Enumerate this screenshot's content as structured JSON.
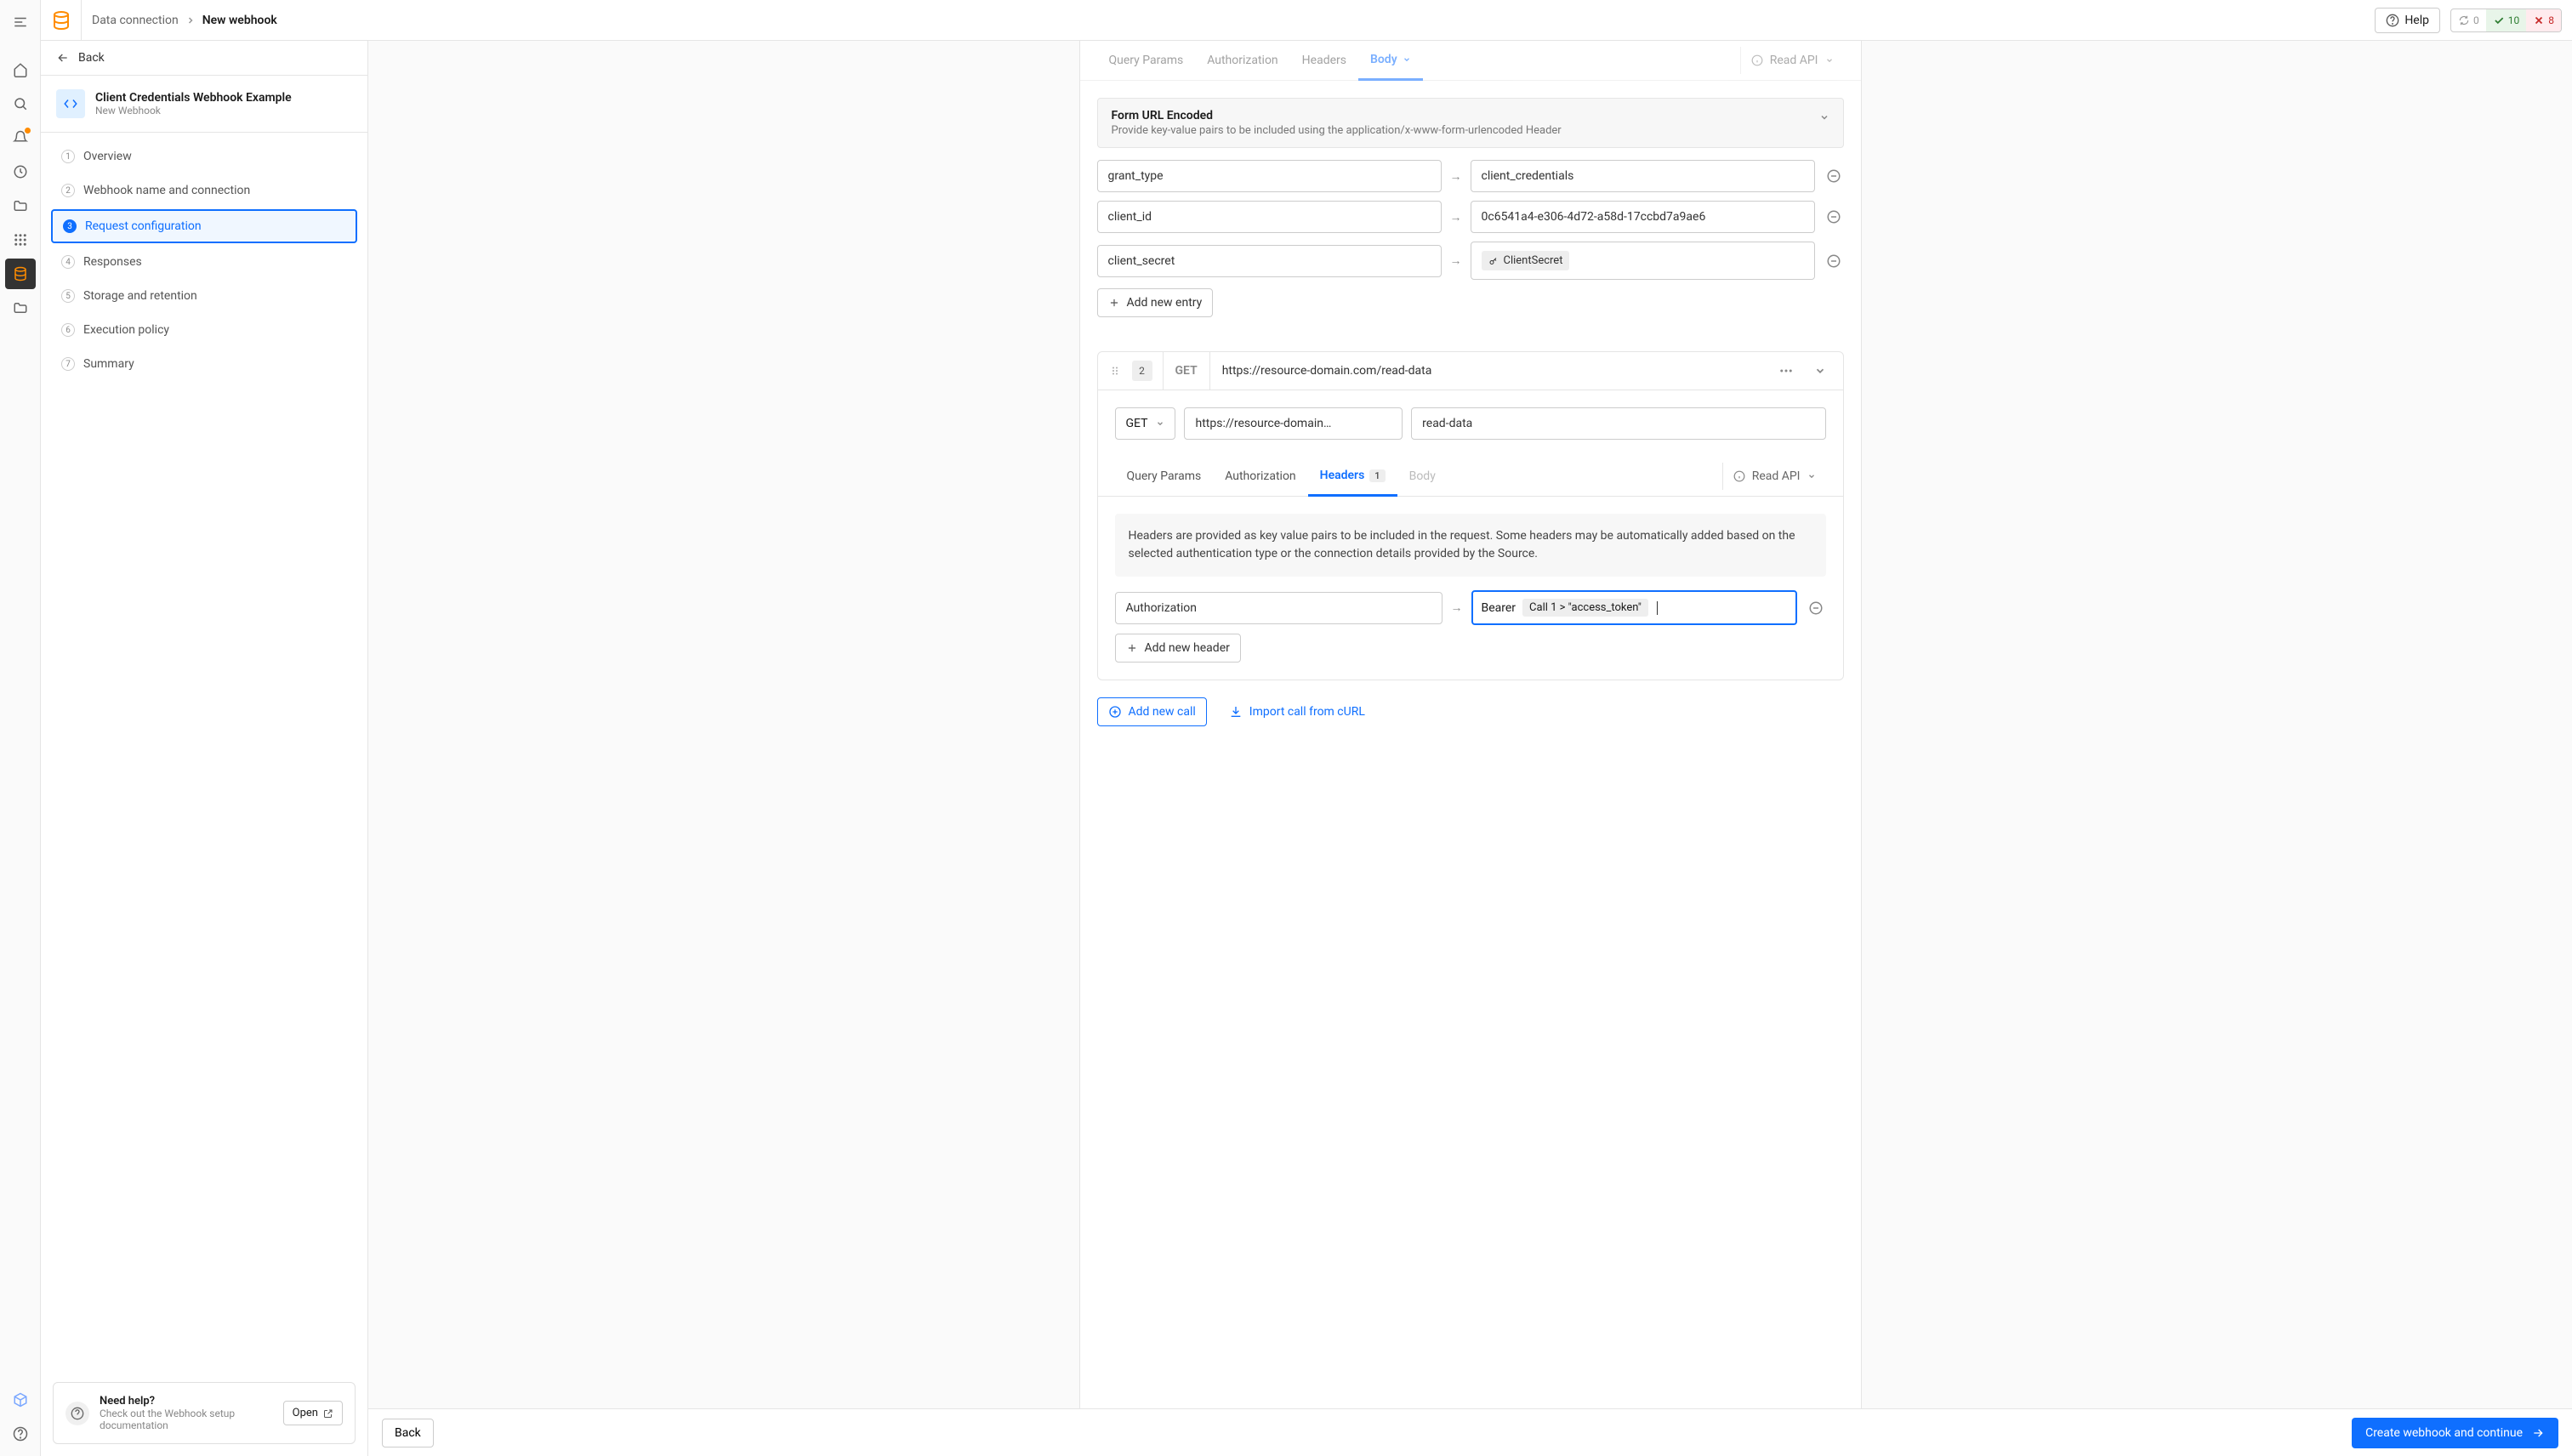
{
  "topbar": {
    "breadcrumb_root": "Data connection",
    "breadcrumb_current": "New webhook",
    "help_label": "Help",
    "status_sync": "0",
    "status_ok": "10",
    "status_err": "8"
  },
  "sidebar": {
    "back_label": "Back",
    "title": "Client Credentials Webhook Example",
    "subtitle": "New Webhook",
    "steps": [
      {
        "n": "1",
        "label": "Overview"
      },
      {
        "n": "2",
        "label": "Webhook name and connection"
      },
      {
        "n": "3",
        "label": "Request configuration"
      },
      {
        "n": "4",
        "label": "Responses"
      },
      {
        "n": "5",
        "label": "Storage and retention"
      },
      {
        "n": "6",
        "label": "Execution policy"
      },
      {
        "n": "7",
        "label": "Summary"
      }
    ],
    "help_title": "Need help?",
    "help_sub": "Check out the Webhook setup documentation",
    "open_label": "Open"
  },
  "body_section": {
    "tabs": {
      "qp": "Query Params",
      "auth": "Authorization",
      "headers": "Headers",
      "body": "Body"
    },
    "read_api": "Read API",
    "form_note_title": "Form URL Encoded",
    "form_note_sub": "Provide key-value pairs to be included using the application/x-www-form-urlencoded Header",
    "rows": [
      {
        "k": "grant_type",
        "v": "client_credentials"
      },
      {
        "k": "client_id",
        "v": "0c6541a4-e306-4d72-a58d-17ccbd7a9ae6"
      },
      {
        "k": "client_secret",
        "v": "ClientSecret"
      }
    ],
    "add_entry": "Add new entry"
  },
  "call2": {
    "num": "2",
    "method": "GET",
    "url": "https://resource-domain.com/read-data",
    "method_sel": "GET",
    "url_input": "https://resource-domain…",
    "name": "read-data",
    "tabs": {
      "qp": "Query Params",
      "auth": "Authorization",
      "headers": "Headers",
      "headers_badge": "1",
      "body": "Body"
    },
    "read_api": "Read API",
    "info": "Headers are provided as key value pairs to be included in the request. Some headers may be automatically added based on the selected authentication type or the connection details provided by the Source.",
    "hdr_key": "Authorization",
    "hdr_prefix": "Bearer",
    "hdr_chip": "Call 1 > \"access_token\"",
    "add_header": "Add new header"
  },
  "actions": {
    "add_call": "Add new call",
    "import": "Import call from cURL"
  },
  "footer": {
    "back": "Back",
    "primary": "Create webhook and continue"
  }
}
